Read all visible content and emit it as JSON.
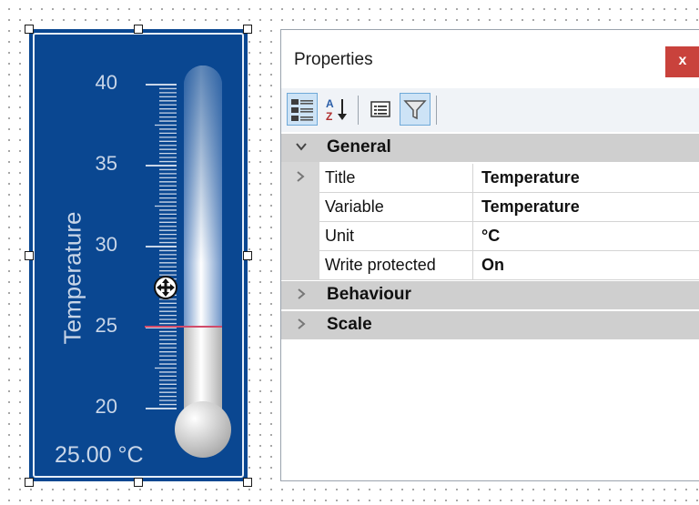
{
  "thermometer": {
    "scale_labels": [
      "40",
      "35",
      "30",
      "25",
      "20"
    ],
    "title": "Temperature",
    "readout": "25.00 °C",
    "colors": {
      "background": "#0a4791",
      "marker": "#d14b6a"
    }
  },
  "properties_panel": {
    "title": "Properties",
    "close_label": "x",
    "toolbar": {
      "buttons": [
        "categorized-icon",
        "alphabetical-sort-icon",
        "property-pages-icon",
        "filter-icon"
      ]
    },
    "categories": [
      {
        "label": "General",
        "expanded": true,
        "properties": [
          {
            "name": "Title",
            "value": "Temperature"
          },
          {
            "name": "Variable",
            "value": "Temperature"
          },
          {
            "name": "Unit",
            "value": "°C"
          },
          {
            "name": "Write protected",
            "value": "On"
          }
        ]
      },
      {
        "label": "Behaviour",
        "expanded": false
      },
      {
        "label": "Scale",
        "expanded": false
      }
    ]
  }
}
